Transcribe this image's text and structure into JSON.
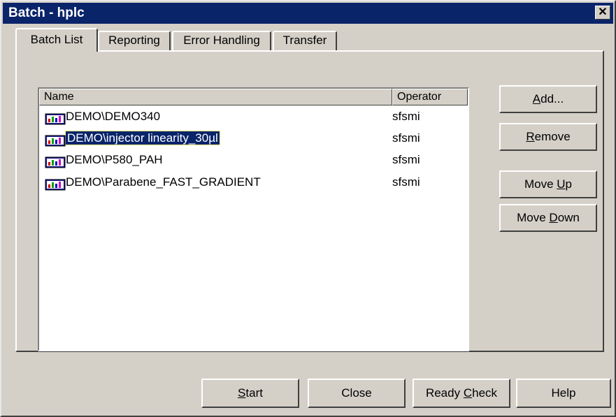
{
  "window": {
    "title": "Batch - hplc",
    "close_glyph": "✕"
  },
  "tabs": [
    {
      "label": "Batch List",
      "active": true
    },
    {
      "label": "Reporting",
      "active": false
    },
    {
      "label": "Error Handling",
      "active": false
    },
    {
      "label": "Transfer",
      "active": false
    }
  ],
  "list": {
    "columns": [
      "Name",
      "Operator"
    ],
    "rows": [
      {
        "name": "DEMO\\DEMO340",
        "operator": "sfsmi",
        "icon": "sequence-icon",
        "selected": false
      },
      {
        "name": "DEMO\\injector linearity_30µl",
        "operator": "sfsmi",
        "icon": "sequence-icon",
        "selected": true
      },
      {
        "name": "DEMO\\P580_PAH",
        "operator": "sfsmi",
        "icon": "sequence-icon",
        "selected": false
      },
      {
        "name": "DEMO\\Parabene_FAST_GRADIENT",
        "operator": "sfsmi",
        "icon": "sequence-icon",
        "selected": false
      }
    ]
  },
  "side_buttons": {
    "add": {
      "pre": "",
      "key": "A",
      "post": "dd..."
    },
    "remove": {
      "pre": "",
      "key": "R",
      "post": "emove"
    },
    "move_up": {
      "pre": "Move ",
      "key": "U",
      "post": "p"
    },
    "move_down": {
      "pre": "Move ",
      "key": "D",
      "post": "own"
    }
  },
  "bottom_buttons": {
    "start": {
      "pre": "",
      "key": "S",
      "post": "tart"
    },
    "close": {
      "pre": "Close",
      "key": "",
      "post": ""
    },
    "ready_check": {
      "pre": "Ready ",
      "key": "C",
      "post": "heck"
    },
    "help": {
      "pre": "Help",
      "key": "",
      "post": ""
    }
  },
  "colors": {
    "title_bar": "#0a246a",
    "face": "#d4d0c8",
    "selection": "#0a246a"
  }
}
